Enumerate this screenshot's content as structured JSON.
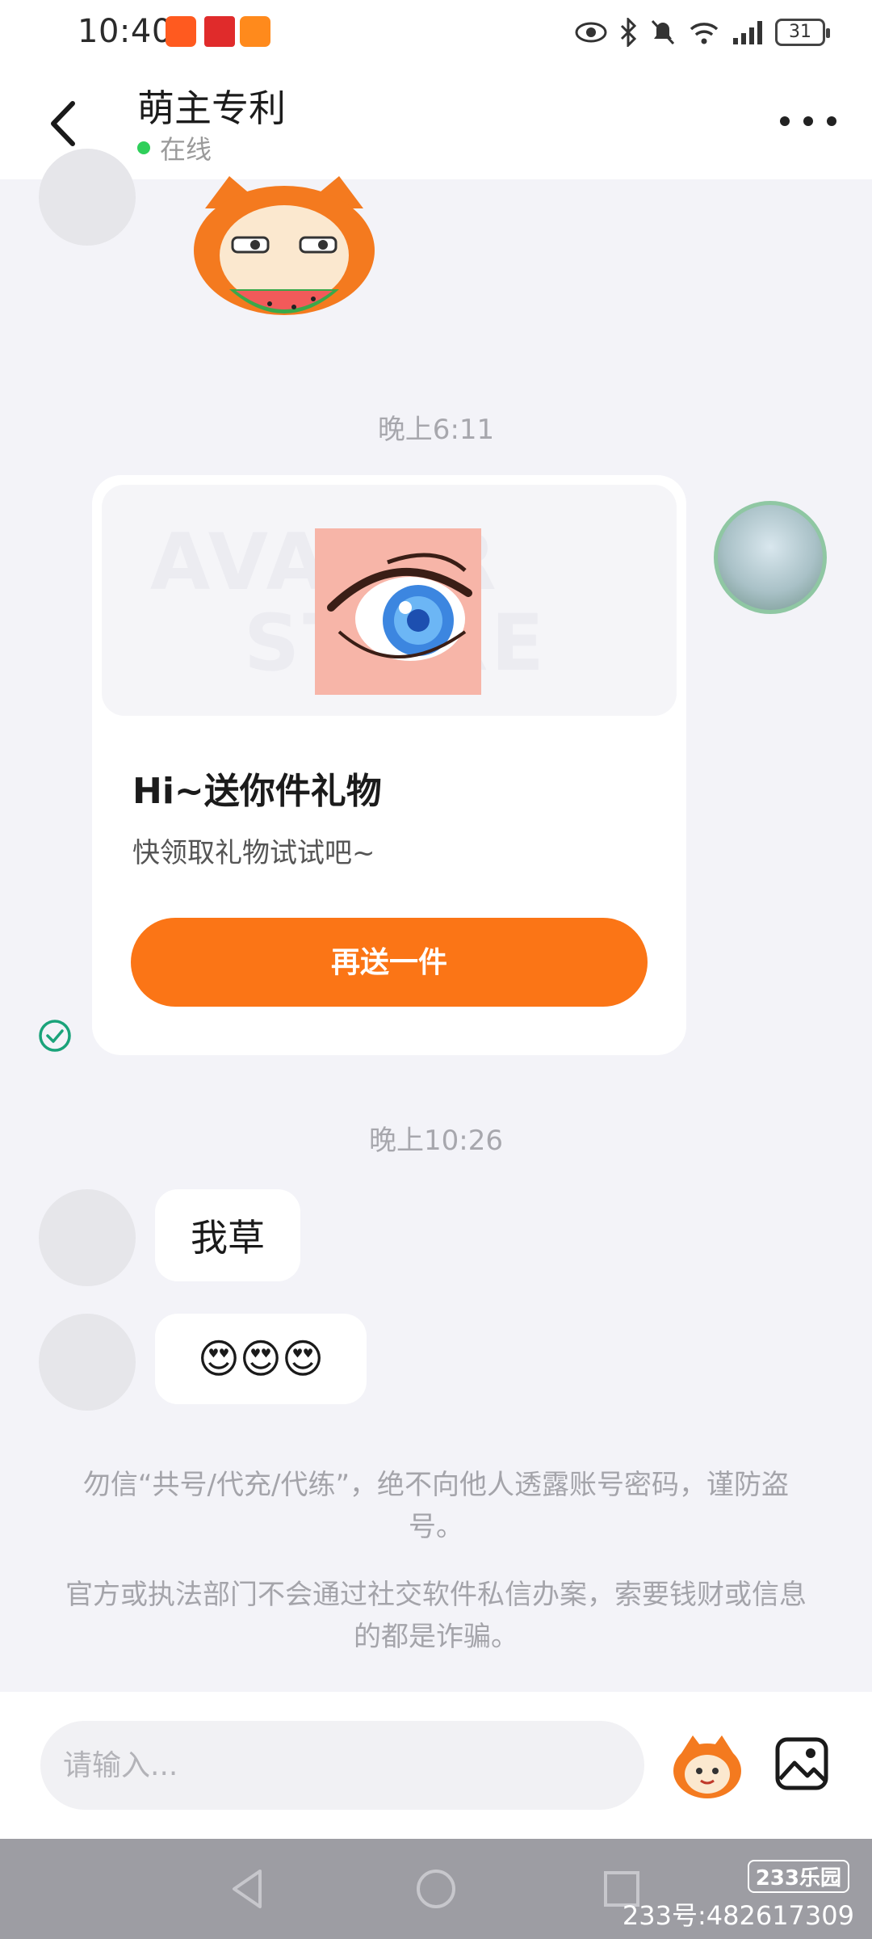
{
  "status_bar": {
    "time": "10:40",
    "battery": "31"
  },
  "header": {
    "title": "萌主专利",
    "status": "在线"
  },
  "messages": {
    "timestamp_1": "晚上6:11",
    "gift_card": {
      "watermark_line1": "AVATAR",
      "watermark_line2": "STORE",
      "title": "Hi~送你件礼物",
      "subtitle": "快领取礼物试试吧~",
      "button_label": "再送一件"
    },
    "timestamp_2": "晚上10:26",
    "text_message": "我草",
    "emoji_message": "😍😍😍"
  },
  "notices": {
    "line_1": "勿信“共号/代充/代练”，绝不向他人透露账号密码，谨防盗号。",
    "line_2": "官方或执法部门不会通过社交软件私信办案，索要钱财或信息的都是诈骗。"
  },
  "input_bar": {
    "placeholder": "请输入..."
  },
  "watermark": {
    "logo": "233乐园",
    "id": "233号:482617309"
  },
  "colors": {
    "accent_orange": "#fb7516",
    "online_green": "#2fcf5a",
    "sent_check_green": "#1aa37a",
    "page_bg": "#f3f3f8"
  },
  "icons": {
    "back": "chevron-left-icon",
    "more": "more-dots-icon",
    "sent": "check-circle-icon",
    "mascot": "mascot-emoji-icon",
    "image": "image-icon"
  }
}
